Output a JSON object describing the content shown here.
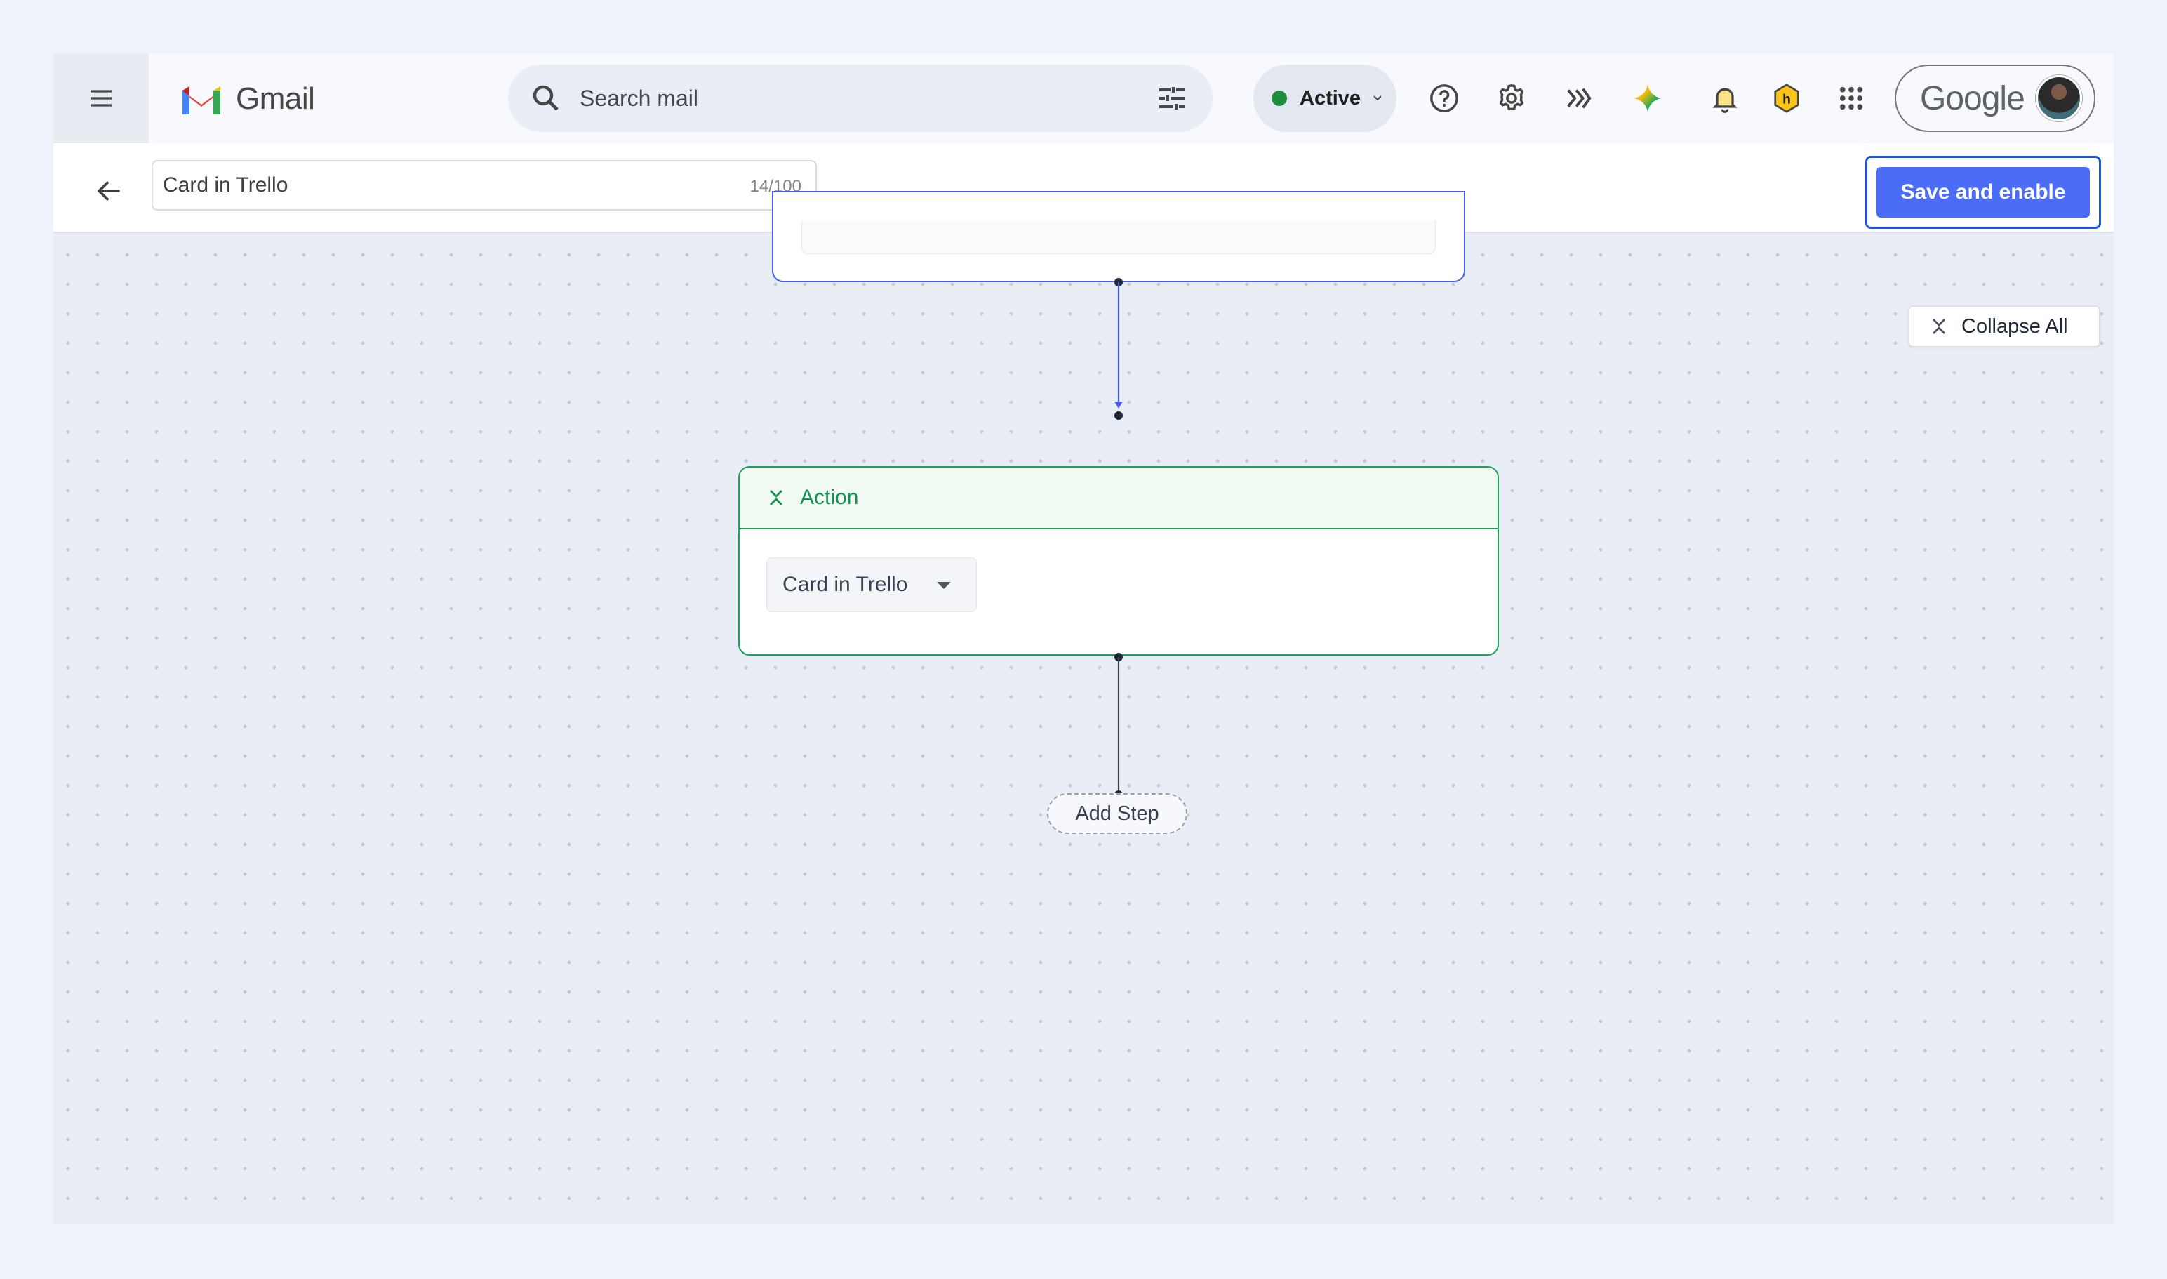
{
  "gmail": {
    "menu_icon": "hamburger-menu-icon",
    "logo_icon": "gmail-m-logo",
    "logo_text": "Gmail",
    "search": {
      "placeholder": "Search mail",
      "value": ""
    },
    "status": {
      "label": "Active",
      "color": "#1e8e3e"
    },
    "header_icons": [
      "help-icon",
      "settings-icon",
      "extension-icon",
      "gemini-icon",
      "notifications-icon",
      "honey-icon",
      "apps-grid-icon"
    ],
    "account": {
      "brand": "Google",
      "avatar_icon": "avatar"
    }
  },
  "editor": {
    "workflow_name": "Card in Trello",
    "char_count": "14/100",
    "save_label": "Save and enable",
    "collapse_label": "Collapse All"
  },
  "flow": {
    "action_card": {
      "title": "Action",
      "app_selected": "Card in Trello"
    },
    "add_step_label": "Add Step"
  },
  "colors": {
    "accent_blue": "#4a6cf7",
    "action_green": "#1aa35a",
    "canvas_bg": "#e9edf5"
  }
}
